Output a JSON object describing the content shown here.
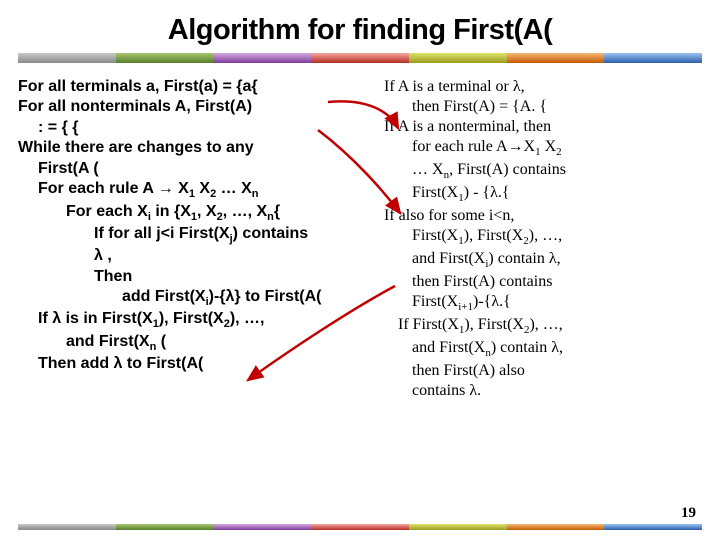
{
  "title": "Algorithm for finding First(A(",
  "left": {
    "l1": "For all terminals a, First(a) = {a{",
    "l2": "For all nonterminals A, First(A)",
    "l3": ": = { {",
    "l4": "While there are changes to any",
    "l5": "First(A (",
    "l6a": "For each rule A ",
    "l6b": "→",
    "l6c": " X",
    "l6s1": "1",
    "l6d": " X",
    "l6s2": "2",
    "l6e": " … X",
    "l6sn": "n",
    "l7a": "For each X",
    "l7si": "i",
    "l7b": " in {X",
    "l7s1": "1",
    "l7c": ", X",
    "l7s2": "2",
    "l7d": ", …, X",
    "l7sn": "n",
    "l7e": "{",
    "l8a": "If for all j<i First(X",
    "l8sj": "j",
    "l8b": ") contains",
    "l9a": "λ ,",
    "l10": "Then",
    "l11a": "add First(X",
    "l11si": "i",
    "l11b": ")-{λ} to First(A(",
    "l12a": "If λ is in First(X",
    "l12s1": "1",
    "l12b": "), First(X",
    "l12s2": "2",
    "l12c": "), …,",
    "l13a": "and First(X",
    "l13sn": "n",
    "l13b": " (",
    "l14": "Then add λ to First(A("
  },
  "right": {
    "r1": "If A is a terminal or λ,",
    "r2": "then First(A) = {A. {",
    "r3": "If A is a nonterminal, then",
    "r4a": "for each rule A→X",
    "r4s1": "1",
    "r4b": " X",
    "r4s2": "2",
    "r5a": "… X",
    "r5sn": "n",
    "r5b": ", First(A) contains",
    "r6a": "First(X",
    "r6s1": "1",
    "r6b": ") - {λ.{",
    "r7": "If also for some i<n,",
    "r8a": "First(X",
    "r8s1": "1",
    "r8b": "), First(X",
    "r8s2": "2",
    "r8c": "), …,",
    "r9a": "and First(X",
    "r9si": "i",
    "r9b": ") contain λ,",
    "r10": "then First(A) contains",
    "r11a": "First(X",
    "r11si1": "i+1",
    "r11b": ")-{λ.{",
    "r12a": "If First(X",
    "r12s1": "1",
    "r12b": "), First(X",
    "r12s2": "2",
    "r12c": "), …,",
    "r13a": "and First(X",
    "r13sn": "n",
    "r13b": ") contain λ,",
    "r14": "then First(A) also",
    "r15": "contains λ."
  },
  "pageNum": "19",
  "colors": {
    "arrow": "#c00000"
  }
}
